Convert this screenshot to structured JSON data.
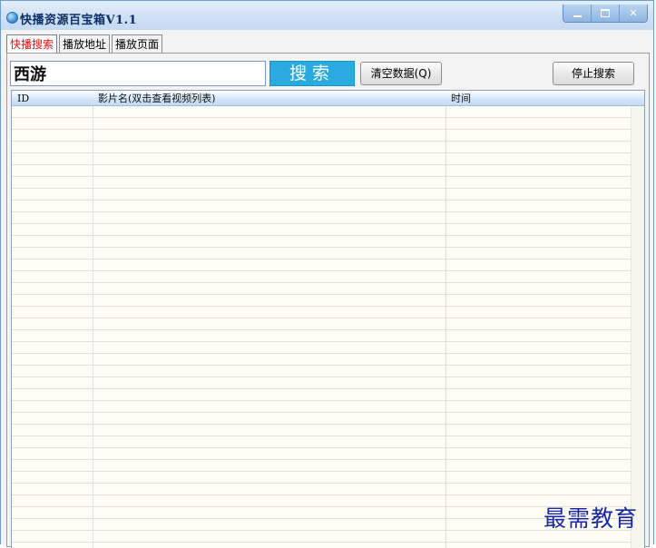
{
  "window": {
    "title": "快播资源百宝箱V1.1",
    "icon": "globe-icon",
    "accent_color": "#2aabe0"
  },
  "tabs": [
    {
      "label": "快播搜索",
      "active": true
    },
    {
      "label": "播放地址",
      "active": false
    },
    {
      "label": "播放页面",
      "active": false
    }
  ],
  "search": {
    "value": "西游",
    "button_label": "搜索",
    "clear_label": "清空数据(Q)",
    "stop_label": "停止搜索"
  },
  "results": {
    "columns": {
      "id": "ID",
      "name": "影片名(双击查看视频列表)",
      "time": "时间"
    },
    "rows": []
  },
  "watermark": "最需教育"
}
